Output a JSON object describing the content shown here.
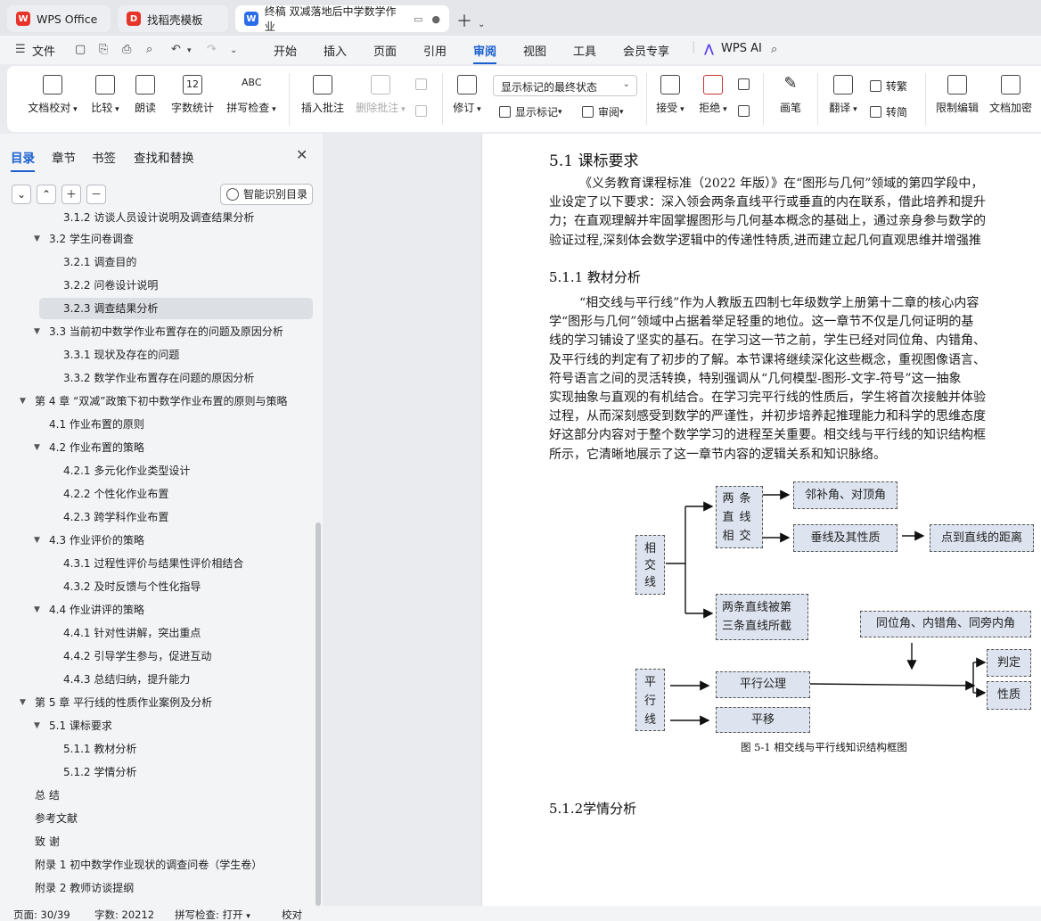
{
  "tabs": [
    {
      "label": "WPS Office",
      "icon": "wps-logo-icon"
    },
    {
      "label": "找稻壳模板",
      "icon": "docer-logo-icon"
    },
    {
      "label": "终稿 双减落地后中学数学作业",
      "icon": "word-doc-icon"
    }
  ],
  "menu": {
    "file": "文件",
    "items": [
      "开始",
      "插入",
      "页面",
      "引用",
      "审阅",
      "视图",
      "工具",
      "会员专享"
    ],
    "active": "审阅",
    "ai": "WPS AI"
  },
  "ribbon": {
    "proofread": "文档校对",
    "compare": "比较",
    "read_aloud": "朗读",
    "word_count": "字数统计",
    "spell_check": "拼写检查",
    "spell_icon_text": "ABC",
    "word_count_icon_text": "12",
    "insert_comment": "插入批注",
    "delete_comment": "删除批注",
    "revise": "修订",
    "markup_select": "显示标记的最终状态",
    "show_markup": "显示标记",
    "review": "审阅",
    "accept": "接受",
    "reject": "拒绝",
    "pen": "画笔",
    "translate": "翻译",
    "to_traditional": "转繁",
    "to_simplified": "转简",
    "restrict_edit": "限制编辑",
    "encrypt": "文档加密"
  },
  "nav": {
    "tabs": [
      "目录",
      "章节",
      "书签",
      "查找和替换"
    ],
    "active_tab": "目录",
    "smart_toc": "智能识别目录",
    "toc": [
      {
        "text": "3.1.2 访谈人员设计说明及调查结果分析",
        "level": 3,
        "arrow": false
      },
      {
        "text": "3.2 学生问卷调查",
        "level": 2,
        "arrow": true
      },
      {
        "text": "3.2.1 调查目的",
        "level": 3,
        "arrow": false
      },
      {
        "text": "3.2.2 问卷设计说明",
        "level": 3,
        "arrow": false
      },
      {
        "text": "3.2.3 调查结果分析",
        "level": 3,
        "arrow": false,
        "selected": true
      },
      {
        "text": "3.3 当前初中数学作业布置存在的问题及原因分析",
        "level": 2,
        "arrow": true
      },
      {
        "text": "3.3.1 现状及存在的问题",
        "level": 3,
        "arrow": false
      },
      {
        "text": "3.3.2 数学作业布置存在问题的原因分析",
        "level": 3,
        "arrow": false
      },
      {
        "text": "第 4 章 “双减”政策下初中数学作业布置的原则与策略",
        "level": 1,
        "arrow": true
      },
      {
        "text": "4.1 作业布置的原则",
        "level": 2,
        "arrow": false
      },
      {
        "text": "4.2 作业布置的策略",
        "level": 2,
        "arrow": true
      },
      {
        "text": "4.2.1 多元化作业类型设计",
        "level": 3,
        "arrow": false
      },
      {
        "text": "4.2.2 个性化作业布置",
        "level": 3,
        "arrow": false
      },
      {
        "text": "4.2.3 跨学科作业布置",
        "level": 3,
        "arrow": false
      },
      {
        "text": "4.3 作业评价的策略",
        "level": 2,
        "arrow": true
      },
      {
        "text": "4.3.1 过程性评价与结果性评价相结合",
        "level": 3,
        "arrow": false
      },
      {
        "text": "4.3.2 及时反馈与个性化指导",
        "level": 3,
        "arrow": false
      },
      {
        "text": "4.4 作业讲评的策略",
        "level": 2,
        "arrow": true
      },
      {
        "text": "4.4.1 针对性讲解，突出重点",
        "level": 3,
        "arrow": false
      },
      {
        "text": "4.4.2 引导学生参与，促进互动",
        "level": 3,
        "arrow": false
      },
      {
        "text": "4.4.3 总结归纳，提升能力",
        "level": 3,
        "arrow": false
      },
      {
        "text": "第 5 章 平行线的性质作业案例及分析",
        "level": 1,
        "arrow": true
      },
      {
        "text": "5.1 课标要求",
        "level": 2,
        "arrow": true
      },
      {
        "text": "5.1.1 教材分析",
        "level": 3,
        "arrow": false
      },
      {
        "text": "5.1.2 学情分析",
        "level": 3,
        "arrow": false
      },
      {
        "text": "总 结",
        "level": 1,
        "arrow": false
      },
      {
        "text": "参考文献",
        "level": 1,
        "arrow": false
      },
      {
        "text": "致 谢",
        "level": 1,
        "arrow": false
      },
      {
        "text": "附录 1 初中数学作业现状的调查问卷（学生卷）",
        "level": 1,
        "arrow": false
      },
      {
        "text": "附录 2 教师访谈提纲",
        "level": 1,
        "arrow": false
      }
    ]
  },
  "document": {
    "heading_51": "5.1 课标要求",
    "para1": [
      "《义务教育课程标准（2022 年版）》在“图形与几何”领域的第四学段中，",
      "业设定了以下要求：深入领会两条直线平行或垂直的内在联系，借此培养和提升",
      "力；在直观理解并牢固掌握图形与几何基本概念的基础上，通过亲身参与数学的",
      "验证过程,深刻体会数学逻辑中的传递性特质,进而建立起几何直观思维并增强推"
    ],
    "heading_511": "5.1.1 教材分析",
    "para2": [
      "“相交线与平行线”作为人教版五四制七年级数学上册第十二章的核心内容",
      "学“图形与几何”领域中占据着举足轻重的地位。这一章节不仅是几何证明的基",
      "线的学习铺设了坚实的基石。在学习这一节之前，学生已经对同位角、内错角、",
      "及平行线的判定有了初步的了解。本节课将继续深化这些概念，重视图像语言、",
      "符号语言之间的灵活转换，特别强调从“几何模型-图形-文字-符号”这一抽象",
      "实现抽象与直观的有机结合。在学习完平行线的性质后，学生将首次接触并体验",
      "过程，从而深刻感受到数学的严谨性，并初步培养起推理能力和科学的思维态度",
      "好这部分内容对于整个数学学习的进程至关重要。相交线与平行线的知识结构框",
      "所示，它清晰地展示了这一章节内容的逻辑关系和知识脉络。"
    ],
    "diagram": {
      "intersecting": "相交线",
      "two_lines_intersect": "两条直线相交",
      "adjacent_angles": "邻补角、对顶角",
      "perpendicular": "垂线及其性质",
      "point_line_distance": "点到直线的距离",
      "cut_by_third": "两条直线被第三条直线所截",
      "angles": "同位角、内错角、同旁内角",
      "parallel": "平行线",
      "parallel_axiom": "平行公理",
      "translation": "平移",
      "judgement": "判定",
      "property": "性质"
    },
    "figure_caption": "图 5-1 相交线与平行线知识结构框图",
    "heading_512": "5.1.2学情分析"
  },
  "status": {
    "page": "页面: 30/39",
    "words": "字数: 20212",
    "spell": "拼写检查: 打开",
    "proof": "校对"
  }
}
